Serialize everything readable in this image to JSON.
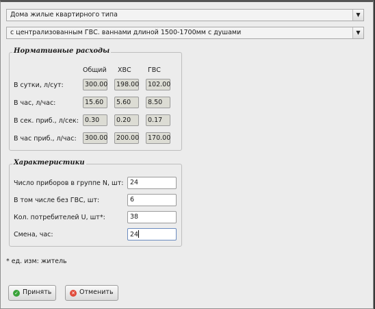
{
  "combos": {
    "building_type": "Дома жилые квартирного типа",
    "water_supply": "с централизованным ГВС. ваннами  длиной 1500-1700мм с душами"
  },
  "norms": {
    "legend": "Нормативные расходы",
    "headers": [
      "Общий",
      "ХВС",
      "ГВС"
    ],
    "rows": [
      {
        "label": "В сутки, л/сут:",
        "values": [
          "300.00",
          "198.00",
          "102.00"
        ]
      },
      {
        "label": "В час, л/час:",
        "values": [
          "15.60",
          "5.60",
          "8.50"
        ]
      },
      {
        "label": "В сек. приб., л/сек:",
        "values": [
          "0.30",
          "0.20",
          "0.17"
        ]
      },
      {
        "label": "В час приб., л/час:",
        "values": [
          "300.00",
          "200.00",
          "170.00"
        ]
      }
    ]
  },
  "chars": {
    "legend": "Характеристики",
    "fields": [
      {
        "label": "Число приборов  в  группе N, шт:",
        "value": "24"
      },
      {
        "label": "В том числе без ГВС, шт:",
        "value": "6"
      },
      {
        "label": "Кол. потребителей U, шт*:",
        "value": "38"
      },
      {
        "label": "Смена, час:",
        "value": "24"
      }
    ]
  },
  "note": "* ед. изм: житель",
  "buttons": {
    "accept": "Принять",
    "cancel": "Отменить"
  },
  "icons": {
    "accept": "check-icon",
    "cancel": "cancel-icon"
  },
  "colors": {
    "accept_icon": "#3aa33a",
    "cancel_icon": "#e04a3a"
  }
}
